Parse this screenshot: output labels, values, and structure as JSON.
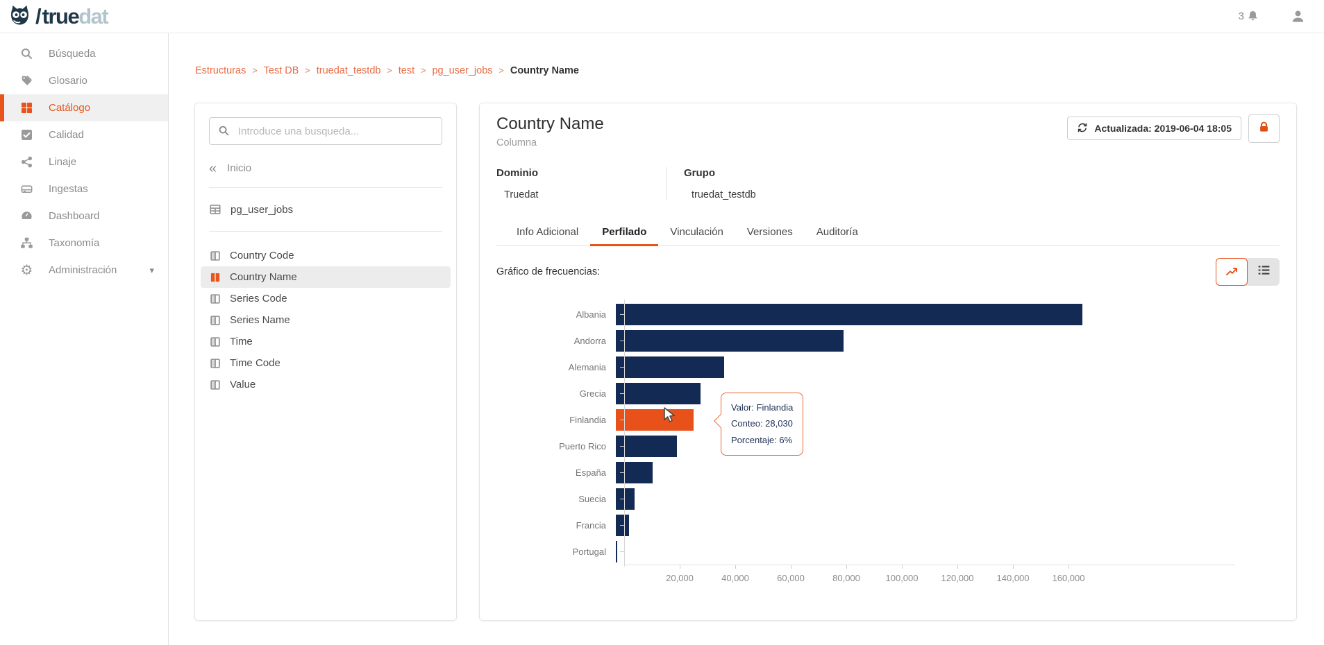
{
  "glyphs": {
    "caret_down": "▾",
    "chevrons_left": "«",
    "crumb_separator": ">",
    "logo_slash": "/"
  },
  "header": {
    "logo": {
      "true_part": "true",
      "dat_part": "dat"
    },
    "notifications": {
      "count": "3"
    }
  },
  "sidebar": {
    "items": [
      {
        "id": "busqueda",
        "label": "Búsqueda",
        "icon": "search-icon"
      },
      {
        "id": "glosario",
        "label": "Glosario",
        "icon": "tags-icon"
      },
      {
        "id": "catalogo",
        "label": "Catálogo",
        "icon": "grid-icon",
        "active": true
      },
      {
        "id": "calidad",
        "label": "Calidad",
        "icon": "check-square-icon"
      },
      {
        "id": "linaje",
        "label": "Linaje",
        "icon": "share-icon"
      },
      {
        "id": "ingestas",
        "label": "Ingestas",
        "icon": "drive-icon"
      },
      {
        "id": "dashboard",
        "label": "Dashboard",
        "icon": "gauge-icon"
      },
      {
        "id": "taxonomia",
        "label": "Taxonomía",
        "icon": "sitemap-icon"
      },
      {
        "id": "administracion",
        "label": "Administración",
        "icon": "gear-icon",
        "caret": true
      }
    ]
  },
  "breadcrumb": {
    "links": [
      "Estructuras",
      "Test DB",
      "truedat_testdb",
      "test",
      "pg_user_jobs"
    ],
    "current": "Country Name"
  },
  "search_panel": {
    "placeholder": "Introduce una busqueda...",
    "back": {
      "label": "Inicio"
    },
    "table": {
      "label": "pg_user_jobs"
    },
    "columns": [
      {
        "label": "Country Code"
      },
      {
        "label": "Country Name",
        "active": true
      },
      {
        "label": "Series Code"
      },
      {
        "label": "Series Name"
      },
      {
        "label": "Time"
      },
      {
        "label": "Time Code"
      },
      {
        "label": "Value"
      }
    ]
  },
  "main": {
    "title": "Country Name",
    "subtitle": "Columna",
    "updated_button": "Actualizada: 2019-06-04 18:05",
    "fields": {
      "dominio_label": "Dominio",
      "dominio_value": "Truedat",
      "grupo_label": "Grupo",
      "grupo_value": "truedat_testdb"
    },
    "tabs": [
      {
        "label": "Info Adicional"
      },
      {
        "label": "Perfilado",
        "active": true
      },
      {
        "label": "Vinculación"
      },
      {
        "label": "Versiones"
      },
      {
        "label": "Auditoría"
      }
    ],
    "section_title": "Gráfico de frecuencias:",
    "tooltip": {
      "lines": [
        "Valor: Finlandia",
        "Conteo: 28,030",
        "Porcentaje: 6%"
      ]
    }
  },
  "chart_data": {
    "type": "bar",
    "orientation": "horizontal",
    "title": "Gráfico de frecuencias:",
    "categories": [
      "Albania",
      "Andorra",
      "Alemania",
      "Grecia",
      "Finlandia",
      "Puerto Rico",
      "España",
      "Suecia",
      "Francia",
      "Portugal"
    ],
    "values": [
      168000,
      82000,
      39000,
      30500,
      28030,
      22000,
      13250,
      6750,
      4750,
      500
    ],
    "highlight": {
      "index": 4,
      "category": "Finlandia",
      "count": "28,030",
      "percentage": "6%"
    },
    "x_ticks": [
      20000,
      40000,
      60000,
      80000,
      100000,
      120000,
      140000,
      160000
    ],
    "x_tick_labels": [
      "20,000",
      "40,000",
      "60,000",
      "80,000",
      "100,000",
      "120,000",
      "140,000",
      "160,000"
    ],
    "xlim": [
      0,
      175000
    ],
    "grid": false,
    "legend": false,
    "bar_color": "#132a54",
    "highlight_color": "#e8521a"
  },
  "colors": {
    "accent": "#e8541c",
    "breadcrumb_link": "#e96b44",
    "bar_navy": "#132a54",
    "bar_highlight": "#e8521a",
    "logo_dark": "#1f3848",
    "logo_light": "#b4c4cd"
  }
}
